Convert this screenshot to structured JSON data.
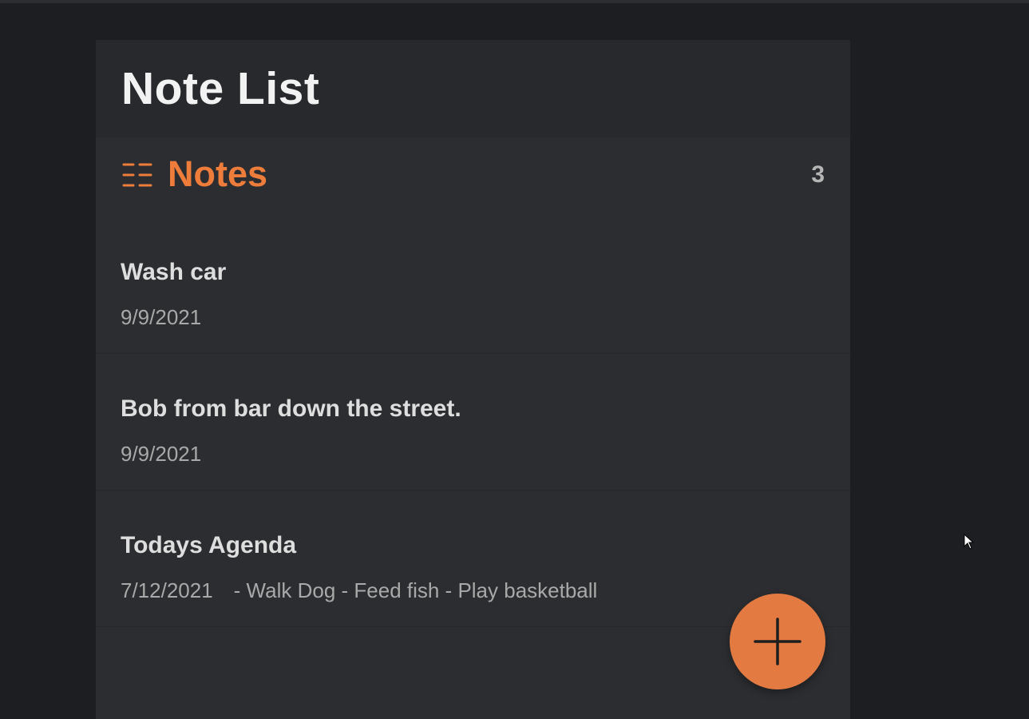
{
  "header": {
    "title": "Note List"
  },
  "section": {
    "icon": "list-icon",
    "title": "Notes",
    "count": "3"
  },
  "notes": [
    {
      "title": "Wash car",
      "date": "9/9/2021",
      "preview": ""
    },
    {
      "title": "Bob from bar down the street.",
      "date": "9/9/2021",
      "preview": ""
    },
    {
      "title": "Todays Agenda",
      "date": "7/12/2021",
      "preview": "- Walk Dog - Feed fish - Play basketball"
    }
  ],
  "fab": {
    "icon": "plus-icon"
  },
  "colors": {
    "accent": "#ee7d3b",
    "fab": "#e37a41",
    "background": "#1c1e21",
    "panel": "#2b2d30"
  }
}
